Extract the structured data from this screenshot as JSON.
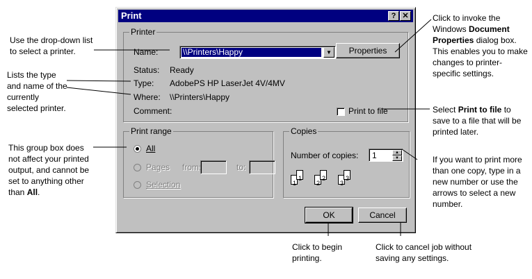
{
  "dialog": {
    "title": "Print",
    "help_button": "?",
    "close_button": "✕",
    "printer_group": {
      "label": "Printer",
      "name_label": "Name:",
      "name_value": "\\\\Printers\\Happy",
      "properties_label": "Properties",
      "status_label": "Status:",
      "status_value": "Ready",
      "type_label": "Type:",
      "type_value": "AdobePS HP LaserJet 4V/4MV",
      "where_label": "Where:",
      "where_value": "\\\\Printers\\Happy",
      "comment_label": "Comment:",
      "print_to_file_label": "Print to file"
    },
    "print_range": {
      "label": "Print range",
      "all_label": "All",
      "pages_label": "Pages",
      "from_label": "from:",
      "to_label": "to:",
      "selection_label": "Selection"
    },
    "copies": {
      "label": "Copies",
      "number_label": "Number of copies:",
      "number_value": "1",
      "collate_pages": [
        "1",
        "1",
        "2",
        "2",
        "3",
        "3"
      ]
    },
    "ok_label": "OK",
    "cancel_label": "Cancel"
  },
  "annotations": {
    "dropdown_note": {
      "pre": "Use the drop-down list to select a printer."
    },
    "type_note": {
      "pre": "Lists the type and name of the currently selected printer."
    },
    "properties_note": {
      "pre": "Click to invoke the Windows ",
      "bold": "Document Properties",
      "post": " dialog box. This enables you to make changes to printer-specific settings."
    },
    "print_to_file_note": {
      "pre": "Select ",
      "bold": "Print to file",
      "post": " to save to a file that will be printed later."
    },
    "range_note": {
      "pre": "This group box does not affect your printed output, and cannot be set to anything other than ",
      "bold": "All",
      "post": "."
    },
    "copies_note": {
      "pre": "If you want to print more than one copy, type in a new number or use the arrows to select a new number."
    },
    "ok_note": {
      "pre": "Click to begin printing."
    },
    "cancel_note": {
      "pre": "Click to cancel job without saving any settings."
    }
  }
}
